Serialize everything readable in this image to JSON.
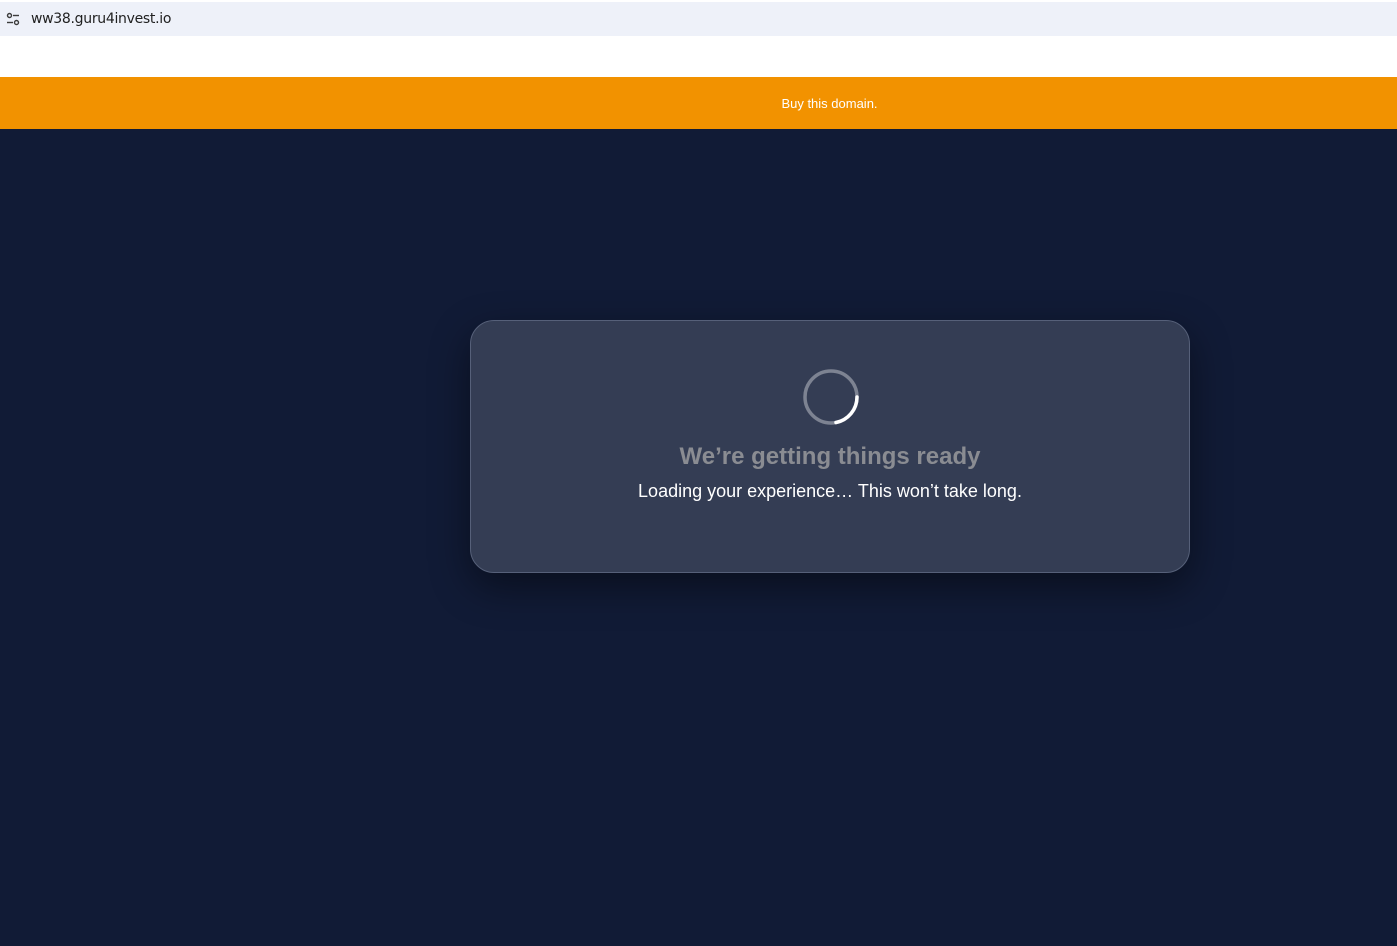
{
  "browser": {
    "url": "ww38.guru4invest.io",
    "site_info_icon": "site-settings-icon"
  },
  "banner": {
    "link_text": "Buy this domain.",
    "color": "#f29200"
  },
  "page": {
    "background": "#111b36"
  },
  "loader": {
    "spinner_icon": "loading-spinner-icon",
    "heading": "We’re getting things ready",
    "subtext": "Loading your experience… This won’t take long.",
    "card_color": "#343d54"
  }
}
